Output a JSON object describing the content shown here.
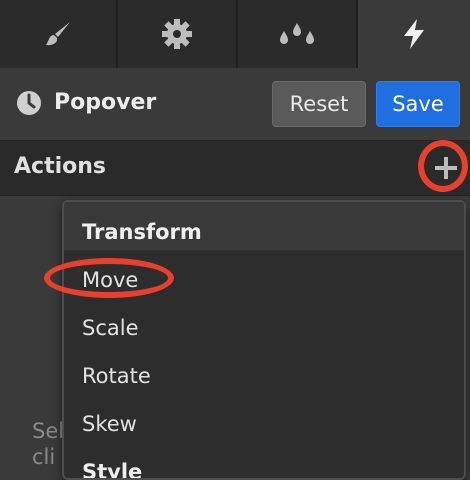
{
  "tabs": [
    {
      "icon": "brush-icon",
      "active": false
    },
    {
      "icon": "gear-icon",
      "active": false
    },
    {
      "icon": "droplets-icon",
      "active": false
    },
    {
      "icon": "lightning-icon",
      "active": true
    }
  ],
  "header": {
    "title": "Popover",
    "title_icon": "clock-icon",
    "reset_label": "Reset",
    "save_label": "Save"
  },
  "actions": {
    "label": "Actions",
    "add_icon": "plus-icon"
  },
  "background_hint": "Sel cli",
  "dropdown": {
    "section": "Transform",
    "items": [
      "Move",
      "Scale",
      "Rotate",
      "Skew"
    ],
    "next_section": "Style"
  },
  "annotations": {
    "highlight_color": "#e8402c"
  },
  "colors": {
    "accent": "#1f6fe0",
    "background": "#3a3a3a"
  }
}
